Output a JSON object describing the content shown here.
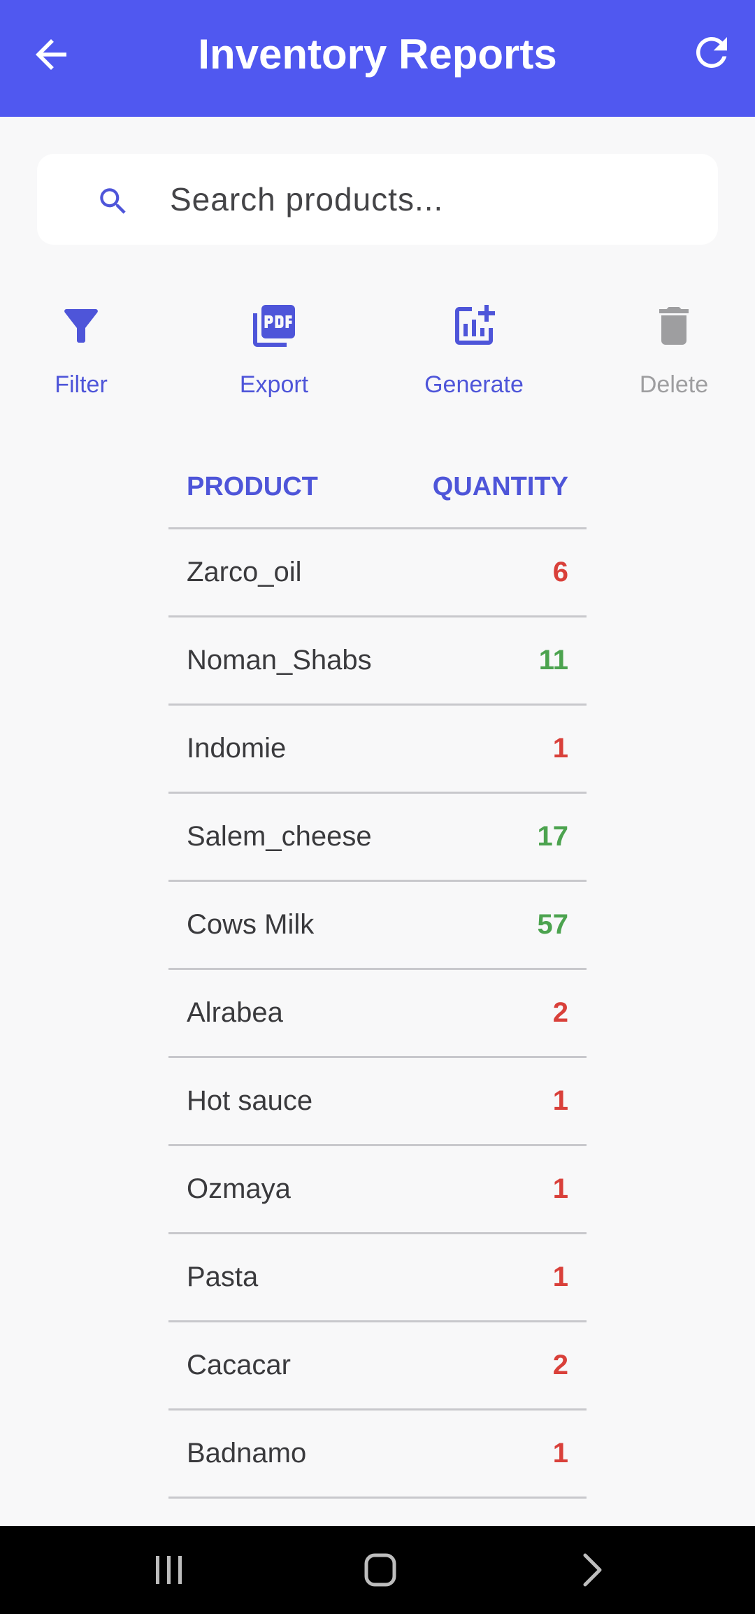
{
  "header": {
    "title": "Inventory Reports",
    "back_icon": "arrow-left-icon",
    "refresh_icon": "refresh-icon",
    "background": "#5058F0"
  },
  "search": {
    "placeholder": "Search products...",
    "icon": "search-icon"
  },
  "actions": [
    {
      "label": "Filter",
      "icon": "filter-icon",
      "enabled": true
    },
    {
      "label": "Export",
      "icon": "pdf-icon",
      "enabled": true
    },
    {
      "label": "Generate",
      "icon": "add-chart-icon",
      "enabled": true
    },
    {
      "label": "Delete",
      "icon": "trash-icon",
      "enabled": false
    }
  ],
  "table": {
    "col_product": "PRODUCT",
    "col_quantity": "QUANTITY",
    "rows": [
      {
        "name": "Zarco_oil",
        "qty": "6",
        "status": "low"
      },
      {
        "name": "Noman_Shabs",
        "qty": "11",
        "status": "ok"
      },
      {
        "name": "Indomie",
        "qty": "1",
        "status": "low"
      },
      {
        "name": "Salem_cheese",
        "qty": "17",
        "status": "ok"
      },
      {
        "name": "Cows Milk",
        "qty": "57",
        "status": "ok"
      },
      {
        "name": "Alrabea",
        "qty": "2",
        "status": "low"
      },
      {
        "name": "Hot sauce",
        "qty": "1",
        "status": "low"
      },
      {
        "name": "Ozmaya",
        "qty": "1",
        "status": "low"
      },
      {
        "name": "Pasta",
        "qty": "1",
        "status": "low"
      },
      {
        "name": "Cacacar",
        "qty": "2",
        "status": "low"
      },
      {
        "name": "Badnamo",
        "qty": "1",
        "status": "low"
      }
    ]
  },
  "colors": {
    "accent": "#4E55D9",
    "low_stock": "#D9403A",
    "ok_stock": "#4CA34F"
  },
  "system_nav": {
    "recents_icon": "recents-icon",
    "home_icon": "home-icon",
    "back_icon": "chevron-right-icon"
  }
}
